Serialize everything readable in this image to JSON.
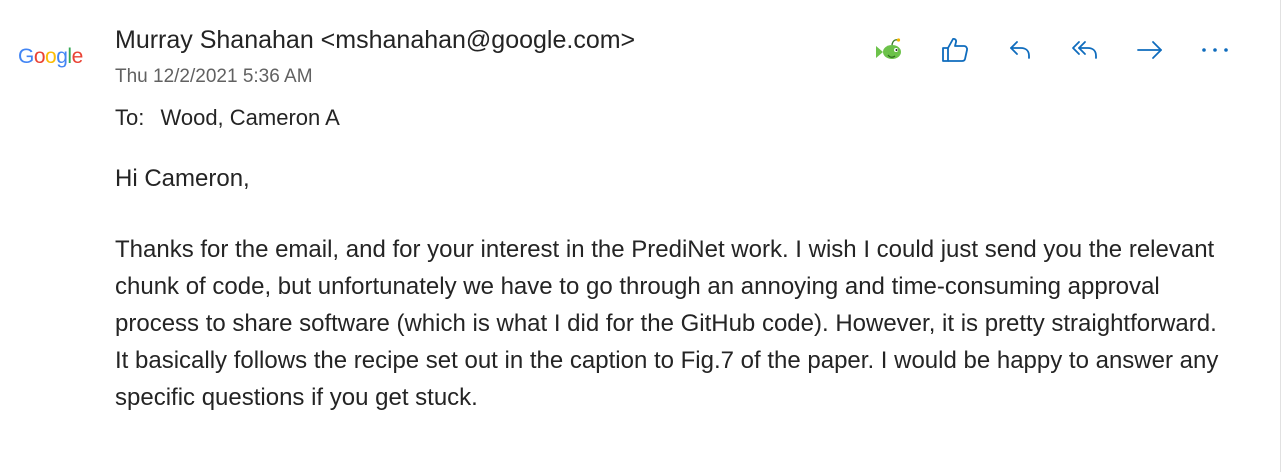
{
  "message": {
    "avatar_text": "Google",
    "sender": "Murray Shanahan <mshanahan@google.com>",
    "date": "Thu 12/2/2021 5:36 AM",
    "to_label": "To:",
    "to_value": "Wood, Cameron A",
    "greeting": "Hi Cameron,",
    "body": "Thanks for the email, and for your interest in the PrediNet work. I wish I could just send you the relevant chunk of code, but unfortunately we have to go through an annoying and time-consuming approval process to share software (which is what I did for the GitHub code). However, it is pretty straightforward. It basically follows the recipe set out in the caption to Fig.7 of the paper. I would be happy to answer any specific questions if you get stuck."
  },
  "toolbar": {
    "icons": [
      "fish-addin-icon",
      "like-icon",
      "reply-icon",
      "reply-all-icon",
      "forward-icon",
      "more-icon"
    ]
  },
  "colors": {
    "accent": "#0f6cbd",
    "text": "#242424",
    "meta": "#616161",
    "google_blue": "#4285f4",
    "google_red": "#ea4335",
    "google_yellow": "#fbbc05",
    "google_green": "#34a853",
    "addin_green": "#6cc24a"
  }
}
